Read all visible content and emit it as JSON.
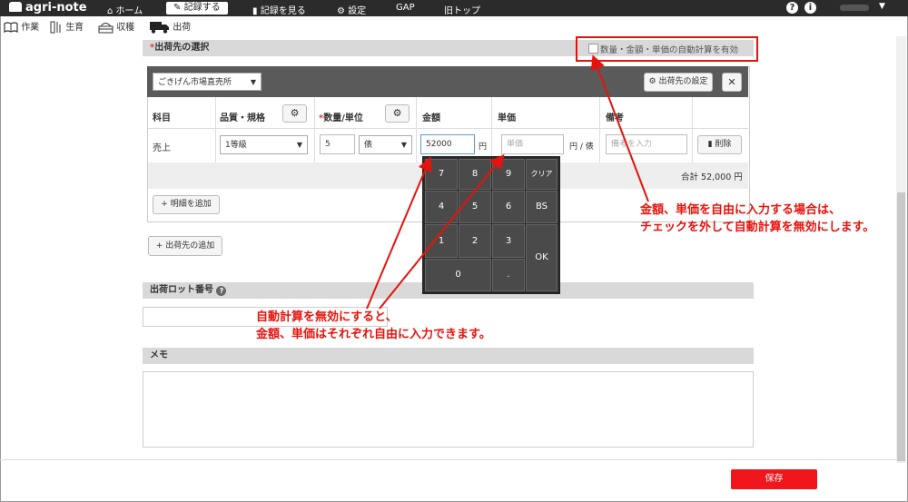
{
  "app": {
    "logo_text": "agri-note"
  },
  "topnav": {
    "items": [
      {
        "label": "ホーム",
        "icon": "home-icon"
      },
      {
        "label": "記録する",
        "icon": "pencil-icon"
      },
      {
        "label": "記録を見る",
        "icon": "notebook-icon"
      },
      {
        "label": "設定",
        "icon": "gear-icon"
      },
      {
        "label": "GAP"
      },
      {
        "label": "旧トップ"
      }
    ],
    "help_glyph": "?",
    "info_glyph": "i"
  },
  "subnav": {
    "items": [
      {
        "label": "作業",
        "icon": "book-icon"
      },
      {
        "label": "生育",
        "icon": "growth-icon"
      },
      {
        "label": "収穫",
        "icon": "basket-icon"
      },
      {
        "label": "出荷",
        "icon": "truck-icon"
      }
    ]
  },
  "shipping_section": {
    "title": "出荷先の選択",
    "required_mark": "*",
    "auto_calc_label": "数量・金額・単価の自動計算を有効",
    "auto_calc_checked": false
  },
  "destination": {
    "selected": "ごきげん市場直売所",
    "settings_button": "出荷先の設定",
    "close_glyph": "✕"
  },
  "table": {
    "headers": {
      "subject": "科目",
      "quality": "品質・規格",
      "quantity_required": "*",
      "quantity": "数量/単位",
      "amount": "金額",
      "unit_price": "単価",
      "remarks": "備考"
    },
    "row": {
      "subject": "売上",
      "quality": "1等級",
      "quantity": "5",
      "unit": "俵",
      "amount": "52000",
      "amount_unit": "円",
      "unit_price_placeholder": "単価",
      "unit_price_unit": "円 / 俵",
      "remarks_placeholder": "備考を入力",
      "delete_button": "削除"
    },
    "total": "合計 52,000 円",
    "add_detail_button": "明細を追加"
  },
  "add_destination_button": "出荷先の追加",
  "keypad": {
    "keys": [
      "7",
      "8",
      "9",
      "クリア",
      "4",
      "5",
      "6",
      "BS",
      "1",
      "2",
      "3",
      "OK",
      "0",
      "."
    ]
  },
  "lot_section": {
    "title": "出荷ロット番号",
    "help_glyph": "?"
  },
  "memo_section": {
    "title": "メモ"
  },
  "save_button": "保存",
  "annotations": {
    "right_line1": "金額、単価を自由に入力する場合は、",
    "right_line2": "チェックを外して自動計算を無効にします。",
    "center_line1": "自動計算を無効にすると、",
    "center_line2": "金額、単価はそれぞれ自由に入力できます。"
  },
  "colors": {
    "annotation_red": "#e8120c",
    "save_red": "#f0161c",
    "nav_dark": "#2b2b2b"
  }
}
